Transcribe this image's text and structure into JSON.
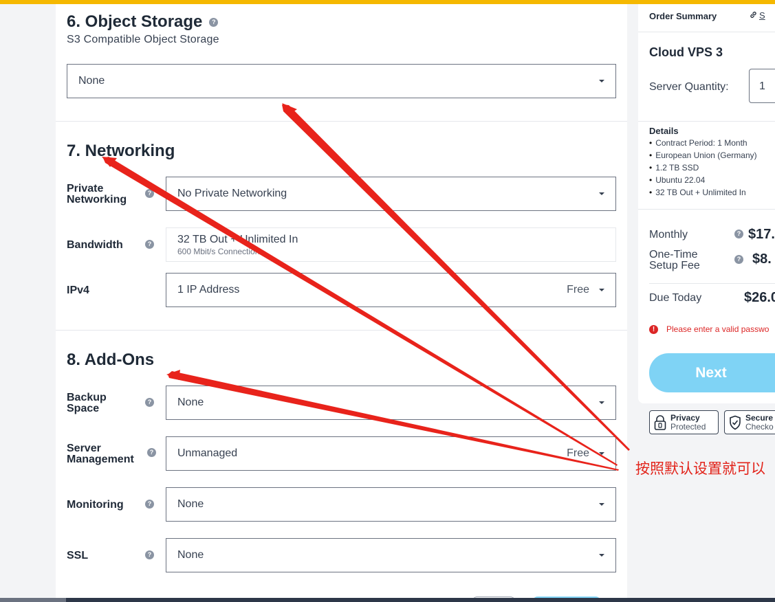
{
  "object_storage": {
    "title": "6. Object Storage",
    "subtitle": "S3 Compatible Object Storage",
    "select_value": "None"
  },
  "networking": {
    "title": "7. Networking",
    "private_networking": {
      "label": "Private Networking",
      "value": "No Private Networking"
    },
    "bandwidth": {
      "label": "Bandwidth",
      "value": "32 TB Out + Unlimited In",
      "detail": "600 Mbit/s Connection"
    },
    "ipv4": {
      "label": "IPv4",
      "value": "1 IP Address",
      "tag": "Free"
    }
  },
  "addons": {
    "title": "8. Add-Ons",
    "backup_space": {
      "label": "Backup Space",
      "value": "None"
    },
    "server_management": {
      "label": "Server Management",
      "value": "Unmanaged",
      "tag": "Free"
    },
    "monitoring": {
      "label": "Monitoring",
      "value": "None"
    },
    "ssl": {
      "label": "SSL",
      "value": "None"
    }
  },
  "help_glyph": "?",
  "summary": {
    "heading": "Order Summary",
    "link_text": "S",
    "plan_name": "Cloud VPS 3",
    "quantity_label": "Server Quantity:",
    "quantity_value": "1",
    "details_title": "Details",
    "details": [
      "Contract Period: 1 Month",
      "European Union (Germany)",
      "1.2 TB SSD",
      "Ubuntu 22.04",
      "32 TB Out + Unlimited In"
    ],
    "monthly_label": "Monthly",
    "monthly_price": "$17.",
    "setup_label": "One-Time Setup Fee",
    "setup_price": "$8.",
    "due_label": "Due Today",
    "due_price": "$26.0",
    "error_text": "Please enter a valid passwo",
    "next_label": "Next"
  },
  "badges": {
    "privacy": {
      "line1": "Privacy",
      "line2": "Protected"
    },
    "secure": {
      "line1": "Secure",
      "line2": "Checko"
    }
  },
  "annotation": {
    "text": "按照默认设置就可以",
    "color": "#e2231a"
  },
  "colors": {
    "accent_bar": "#f5b800",
    "next_button": "#7fd3f5",
    "error": "#dc2626"
  }
}
